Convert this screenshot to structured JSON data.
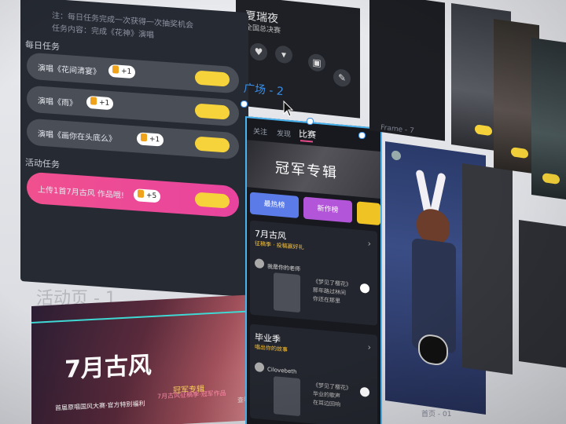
{
  "task_panel": {
    "hint_line1": "注：每日任务完成一次获得一次抽奖机会",
    "hint_line2": "任务内容：完成《花神》演唱",
    "daily_title": "每日任务",
    "daily_tasks": [
      {
        "label": "演唱《花间清宴》",
        "reward": "+1"
      },
      {
        "label": "演唱《雨》",
        "reward": "+1"
      },
      {
        "label": "演唱《画你在头底么》",
        "reward": "+1"
      }
    ],
    "activity_title": "活动任务",
    "activity_task": {
      "label": "上传1首7月古风 作品哦!",
      "reward": "+5"
    }
  },
  "canvas_labels": {
    "activity_page": "活动页 - 1",
    "square_page": "广场 - 2",
    "frame_label": "Frame - 7",
    "bottom_label": "首页 - 01"
  },
  "banner": {
    "title": "7月古风",
    "subtitle": "冠军专辑",
    "foot": "首届原唱国风大赛·官方特别福利",
    "foot2": "7月古风征稿季·冠军作品",
    "more": "查看全部规则"
  },
  "top_card": {
    "title": "夏瑞夜",
    "subtitle": "全国总决赛",
    "icons": [
      "heart-icon",
      "shirt-icon",
      "gift-icon",
      "pencil-icon"
    ]
  },
  "phone": {
    "tabs": [
      {
        "label": "关注",
        "active": false
      },
      {
        "label": "发现",
        "active": false
      },
      {
        "label": "比赛",
        "active": true
      }
    ],
    "hero_text": "冠军专辑",
    "categories": [
      {
        "label": "最热榜",
        "color": "#5b7be8"
      },
      {
        "label": "新作榜",
        "color": "#b355d9"
      },
      {
        "label": "",
        "color": "#f0c325"
      }
    ],
    "entries": [
      {
        "title": "7月古风",
        "tag": "征稿季 · 投稿赢好礼",
        "author": "我是你的老师",
        "text": "《梦见了樱花》\n那年路过林间\n你还在那里"
      },
      {
        "title": "毕业季",
        "tag": "唱出你的故事",
        "author": "Cilovebeth",
        "text": "《梦见了樱花》\n毕业的歌声\n在耳边回响"
      }
    ]
  },
  "colors": {
    "panel_bg": "#262a33",
    "pill_dark": "#4a4e57",
    "pill_pink": "#e8449f",
    "button_yellow": "#f6d33a",
    "selection_blue": "#3b8fe6",
    "guide_cyan": "#3fd8d3"
  }
}
